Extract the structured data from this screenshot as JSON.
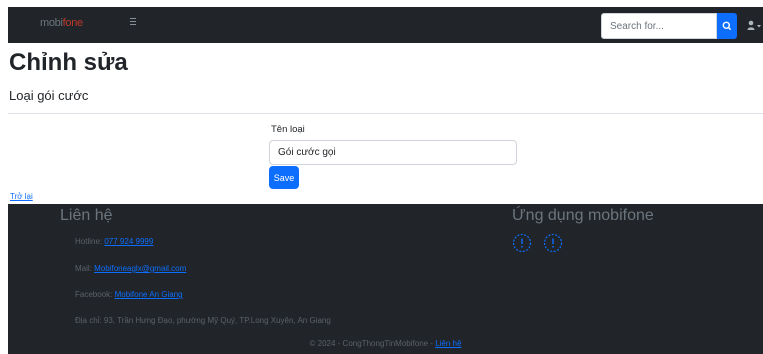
{
  "navbar": {
    "brand_part1": "mobi",
    "brand_part2": "fone",
    "menu_icon": "hamburger-icon",
    "search": {
      "placeholder": "Search for...",
      "button_icon": "search-icon"
    },
    "user_icon": "user-icon",
    "user_caret_icon": "caret-down-icon"
  },
  "header": {
    "title": "Chỉnh sửa",
    "subtitle": "Loại gói cước"
  },
  "form": {
    "field_label": "Tên loại",
    "field_value": "Gói cước gọi",
    "save_label": "Save"
  },
  "back_link": "Trở lại",
  "footer": {
    "contact_heading": "Liên hệ",
    "hotline_label": "Hotline: ",
    "hotline_value": "077 924 9999",
    "mail_label": "Mail: ",
    "mail_value": "Mobifoneaglx@gmail.com",
    "facebook_label": "Facebook: ",
    "facebook_value": "Mobifone An Giang",
    "address": "Địa chỉ: 93, Trần Hưng Đạo, phường Mỹ Quý, TP.Long Xuyên, An Giang",
    "apps_heading": "Ứng dụng mobifone",
    "app_icons": [
      "app-icon",
      "app-icon"
    ],
    "copyright_text": "© 2024 - CongThongTinMobifone - ",
    "copyright_link": "Liên hệ"
  },
  "colors": {
    "navbar_bg": "#212529",
    "primary": "#0d6efd",
    "brand_accent": "#c0392b",
    "footer_text": "#5a6168"
  }
}
